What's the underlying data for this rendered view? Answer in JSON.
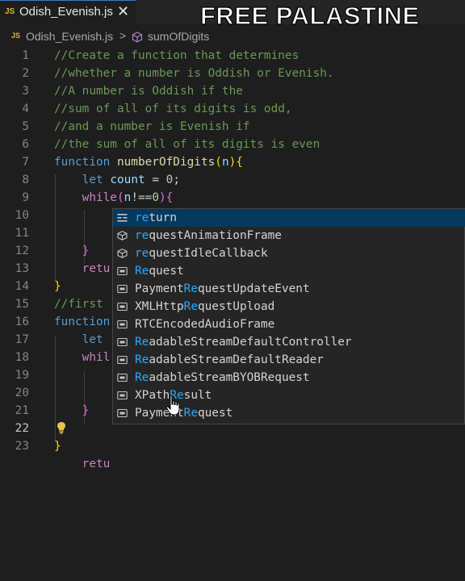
{
  "tab": {
    "badge": "JS",
    "filename": "Odish_Evenish.js",
    "close_glyph": "✕"
  },
  "overlay_text": "FREE PALASTINE",
  "breadcrumb": {
    "badge": "JS",
    "file": "Odish_Evenish.js",
    "separator": ">",
    "symbol": "sumOfDigits",
    "symbol_icon": "cube-icon"
  },
  "editor": {
    "line_numbers": [
      "1",
      "2",
      "3",
      "4",
      "5",
      "6",
      "7",
      "8",
      "9",
      "10",
      "11",
      "12",
      "13",
      "14",
      "15",
      "16",
      "17",
      "18",
      "19",
      "20",
      "21",
      "22",
      "23"
    ],
    "current_line": "22",
    "comments": [
      "//Create a function that determines",
      "//whether a number is Oddish or Evenish.",
      "//A number is Oddish if the",
      "//sum of all of its digits is odd,",
      "//and a number is Evenish if",
      "//the sum of all of its digits is even",
      "//first"
    ],
    "kw_function": "function",
    "fn_number_of_digits": "numberOfDigits",
    "param_n": "n",
    "kw_let": "let",
    "var_count": "count",
    "num_zero": "0",
    "kw_while": "while",
    "op_neq": "!==",
    "retu_partial": "retu",
    "while_partial": "whil"
  },
  "suggestions": {
    "items": [
      {
        "label": "return",
        "match": "re",
        "icon": "keyword-icon",
        "selected": true
      },
      {
        "label": "requestAnimationFrame",
        "match": "re",
        "icon": "method-icon"
      },
      {
        "label": "requestIdleCallback",
        "match": "re",
        "icon": "method-icon"
      },
      {
        "label": "Request",
        "match": "Re",
        "icon": "variable-icon"
      },
      {
        "label": "PaymentRequestUpdateEvent",
        "match": "Re",
        "icon": "variable-icon"
      },
      {
        "label": "XMLHttpRequestUpload",
        "match": "Re",
        "icon": "variable-icon"
      },
      {
        "label": "RTCEncodedAudioFrame",
        "match": "RE",
        "icon": "variable-icon"
      },
      {
        "label": "ReadableStreamDefaultController",
        "match": "Re",
        "icon": "variable-icon"
      },
      {
        "label": "ReadableStreamDefaultReader",
        "match": "Re",
        "icon": "variable-icon"
      },
      {
        "label": "ReadableStreamBYOBRequest",
        "match": "Re",
        "icon": "variable-icon"
      },
      {
        "label": "XPathResult",
        "match": "Re",
        "icon": "variable-icon"
      },
      {
        "label": "PaymentRequest",
        "match": "Re",
        "icon": "variable-icon"
      }
    ],
    "colors": {
      "background": "#252526",
      "selected": "#04395e",
      "match": "#2aaaff"
    }
  }
}
